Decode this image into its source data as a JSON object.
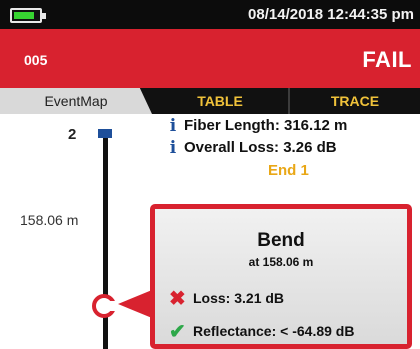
{
  "status_bar": {
    "datetime": "08/14/2018 12:44:35 pm"
  },
  "header": {
    "test_id": "005",
    "result": "FAIL"
  },
  "tabs": [
    {
      "label": "EventMap",
      "active": true
    },
    {
      "label": "TABLE",
      "active": false
    },
    {
      "label": "TRACE",
      "active": false
    }
  ],
  "summary": {
    "fiber_length_label": "Fiber Length:",
    "fiber_length_value": "316.12 m",
    "overall_loss_label": "Overall Loss:",
    "overall_loss_value": "3.26 dB",
    "end_label": "End 1"
  },
  "map": {
    "event_number": "2",
    "event_distance": "158.06 m"
  },
  "event": {
    "type": "Bend",
    "at": "at 158.06 m",
    "loss_label": "Loss:",
    "loss_value": "3.21 dB",
    "reflectance_label": "Reflectance:",
    "reflectance_value": "< -64.89 dB"
  },
  "colors": {
    "fail_red": "#d8222f",
    "tab_text": "#f0c23a",
    "end_label": "#e9a716",
    "info_blue": "#1e4f9a",
    "pass_green": "#2ea84a",
    "battery_green": "#37d431"
  },
  "icons": {
    "battery": "battery-icon",
    "info": "info-icon",
    "fail": "x-mark-icon",
    "pass": "checkmark-icon"
  }
}
